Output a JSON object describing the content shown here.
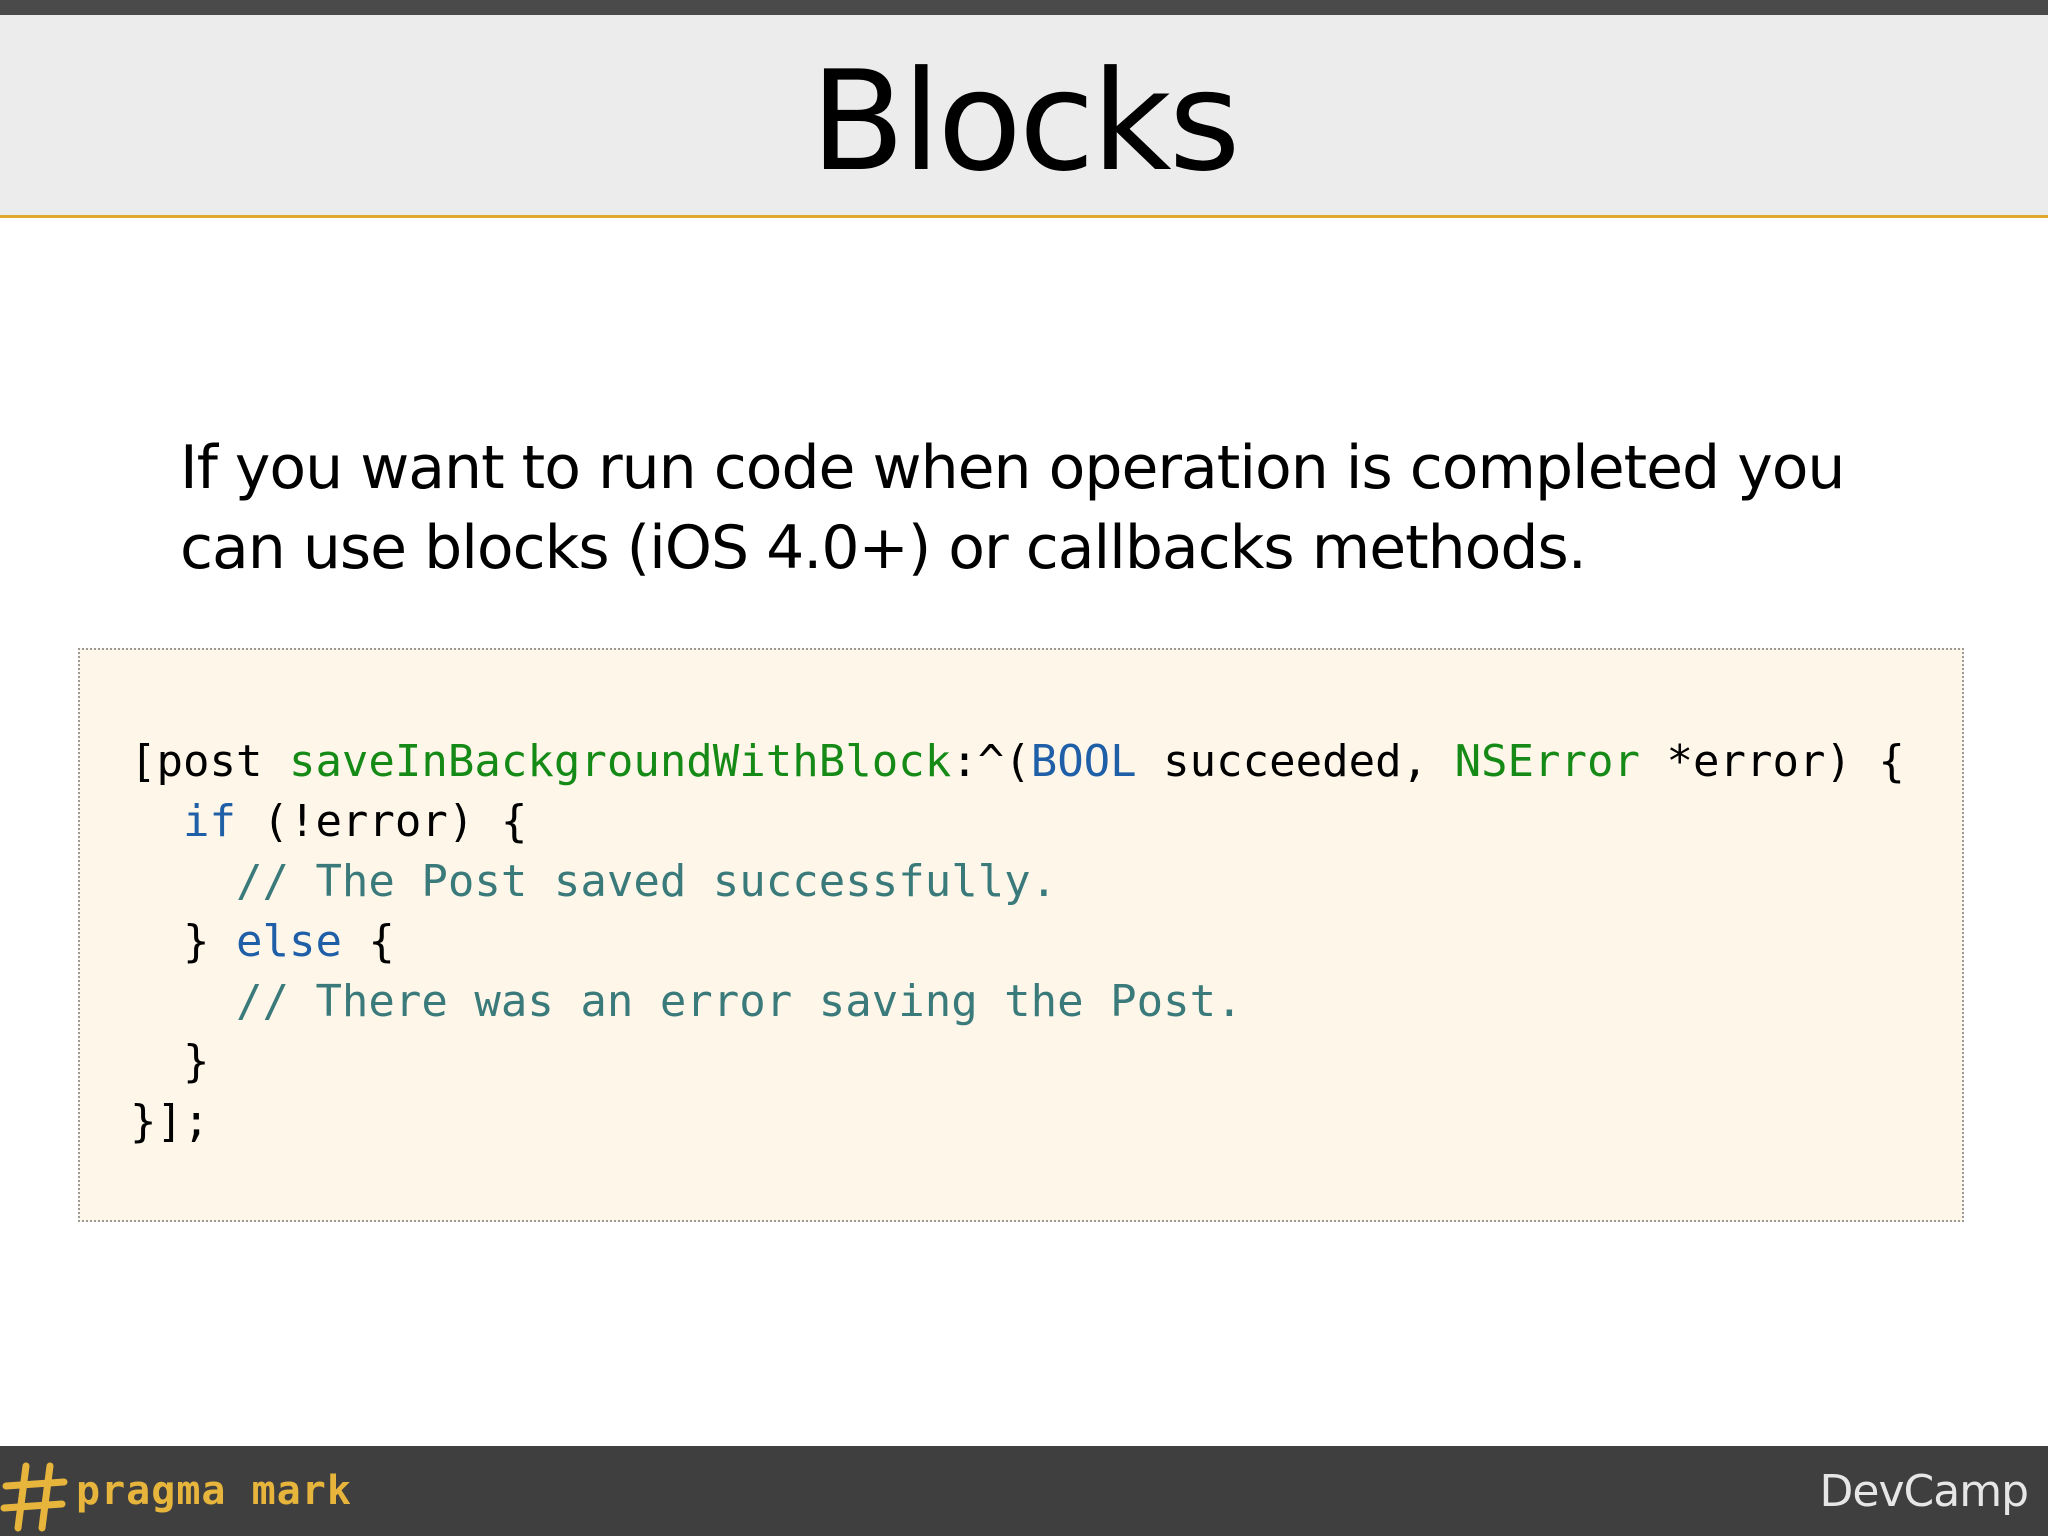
{
  "slide": {
    "title": "Blocks",
    "body_lines": [
      "If you want to run code when operation is completed you",
      "can use blocks (iOS 4.0+) or callbacks methods."
    ]
  },
  "code": {
    "lines": [
      [
        {
          "t": "[post ",
          "k": "plain"
        },
        {
          "t": "saveInBackgroundWithBlock",
          "k": "green"
        },
        {
          "t": ":^(",
          "k": "plain"
        },
        {
          "t": "BOOL",
          "k": "blue"
        },
        {
          "t": " succeeded, ",
          "k": "plain"
        },
        {
          "t": "NSError",
          "k": "green"
        },
        {
          "t": " *error) {",
          "k": "plain"
        }
      ],
      [
        {
          "t": "  ",
          "k": "plain"
        },
        {
          "t": "if",
          "k": "blue"
        },
        {
          "t": " (!error) {",
          "k": "plain"
        }
      ],
      [
        {
          "t": "    ",
          "k": "plain"
        },
        {
          "t": "// The Post saved successfully.",
          "k": "comment"
        }
      ],
      [
        {
          "t": "  } ",
          "k": "plain"
        },
        {
          "t": "else",
          "k": "blue"
        },
        {
          "t": " {",
          "k": "plain"
        }
      ],
      [
        {
          "t": "    ",
          "k": "plain"
        },
        {
          "t": "// There was an error saving the Post.",
          "k": "comment"
        }
      ],
      [
        {
          "t": "  }",
          "k": "plain"
        }
      ],
      [
        {
          "t": "}];",
          "k": "plain"
        }
      ]
    ]
  },
  "footer": {
    "brand": "pragma mark",
    "brand_icon": "hash-icon",
    "event": "DevCamp"
  },
  "colors": {
    "accent": "#e0a92c",
    "title_band": "#ececec",
    "code_bg": "#fdf6e9",
    "footer_bg": "#3f3f3f",
    "code_green": "#168a16",
    "code_blue": "#1f5fa8",
    "code_comment": "#3a7a7a"
  }
}
